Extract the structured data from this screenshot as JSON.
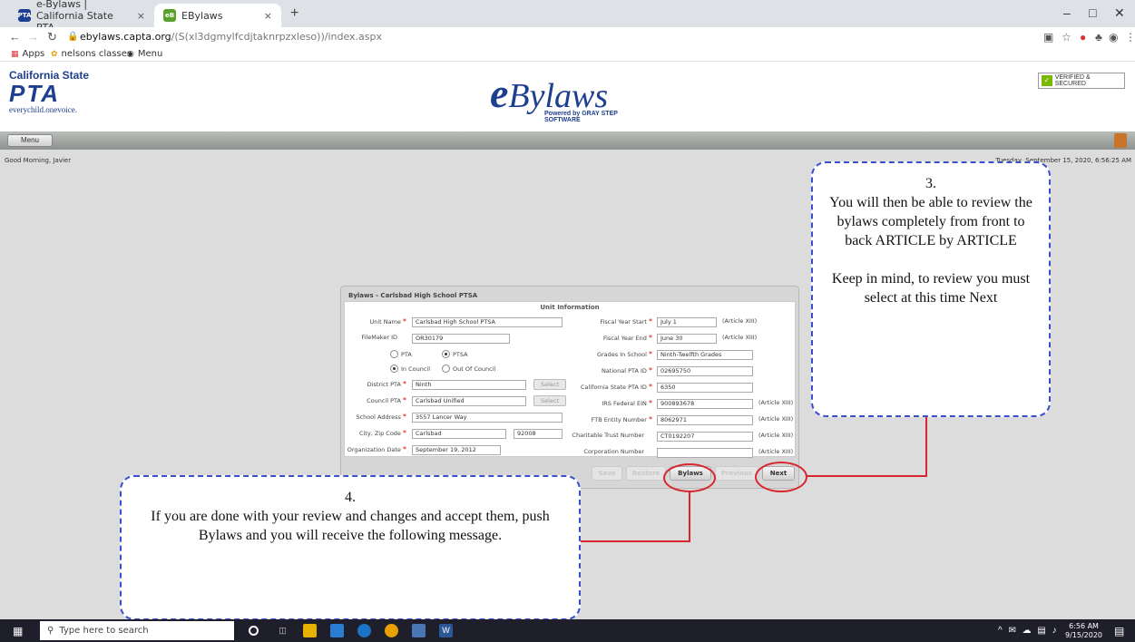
{
  "browser": {
    "tabs": [
      {
        "label": "e-Bylaws | California State PTA",
        "close": "×"
      },
      {
        "label": "EBylaws",
        "close": "×"
      }
    ],
    "new_tab": "+",
    "url_host": "ebylaws.capta.org",
    "url_path": "/(S(xl3dgmylfcdjtaknrpzxleso))/index.aspx",
    "bookmarks": [
      "Apps",
      "nelsons classes",
      "Menu"
    ],
    "window_controls": [
      "–",
      "□",
      "✕"
    ]
  },
  "header": {
    "pta_top": "California State",
    "pta_main": "PTA",
    "pta_tag": "everychild.onevoice.",
    "ebylaws_e": "e",
    "ebylaws_rest": "Bylaws",
    "powered_by": "Powered by GRAY STEP SOFTWARE",
    "verified": "VERIFIED & SECURED"
  },
  "menubar": {
    "menu_label": "Menu"
  },
  "main": {
    "greeting": "Good Morning, Javier",
    "datetime": "Tuesday, September 15, 2020, 6:56:25 AM"
  },
  "panel": {
    "title": "Bylaws - Carlsbad High School PTSA",
    "section": "Unit Information",
    "left": {
      "unit_name_label": "Unit Name",
      "unit_name": "Carlsbad High School PTSA",
      "filemaker_label": "FileMaker ID",
      "filemaker": "OR30179",
      "radio_pta": "PTA",
      "radio_ptsa": "PTSA",
      "radio_in_council": "In Council",
      "radio_out_council": "Out Of Council",
      "district_label": "District PTA",
      "district": "Ninth",
      "council_label": "Council PTA",
      "council": "Carlsbad Unified",
      "select": "Select",
      "address_label": "School Address",
      "address": "3557 Lancer Way",
      "cityzip_label": "City, Zip Code",
      "city": "Carlsbad",
      "zip": "92008",
      "orgdate_label": "Organization Date",
      "orgdate": "September 19, 2012"
    },
    "right": {
      "fy_start_label": "Fiscal Year Start",
      "fy_start": "July 1",
      "fy_end_label": "Fiscal Year End",
      "fy_end": "June 30",
      "grades_label": "Grades In School",
      "grades": "Ninth-Twelfth Grades",
      "national_label": "National PTA ID",
      "national": "02695750",
      "castate_label": "California State PTA ID",
      "castate": "6350",
      "irs_label": "IRS Federal EIN",
      "irs": "900893678",
      "ftb_label": "FTB Entity Number",
      "ftb": "8062971",
      "charity_label": "Charitable Trust Number",
      "charity": "CT0192207",
      "corp_label": "Corporation Number",
      "corp": "",
      "article_xiii": "(Article XIII)"
    },
    "buttons": {
      "save": "Save",
      "restore": "Restore",
      "bylaws": "Bylaws",
      "previous": "Previous",
      "next": "Next"
    }
  },
  "callout3": {
    "number": "3.",
    "text1": "You will then be able to review the bylaws completely from front to back ARTICLE by ARTICLE",
    "text2": "Keep in mind, to review you must select at this time Next"
  },
  "callout4": {
    "number": "4.",
    "text": "If you are done with your review and changes and accept them, push Bylaws and you will receive the following message."
  },
  "taskbar": {
    "search_placeholder": "Type here to search",
    "time": "6:56 AM",
    "date": "9/15/2020"
  }
}
